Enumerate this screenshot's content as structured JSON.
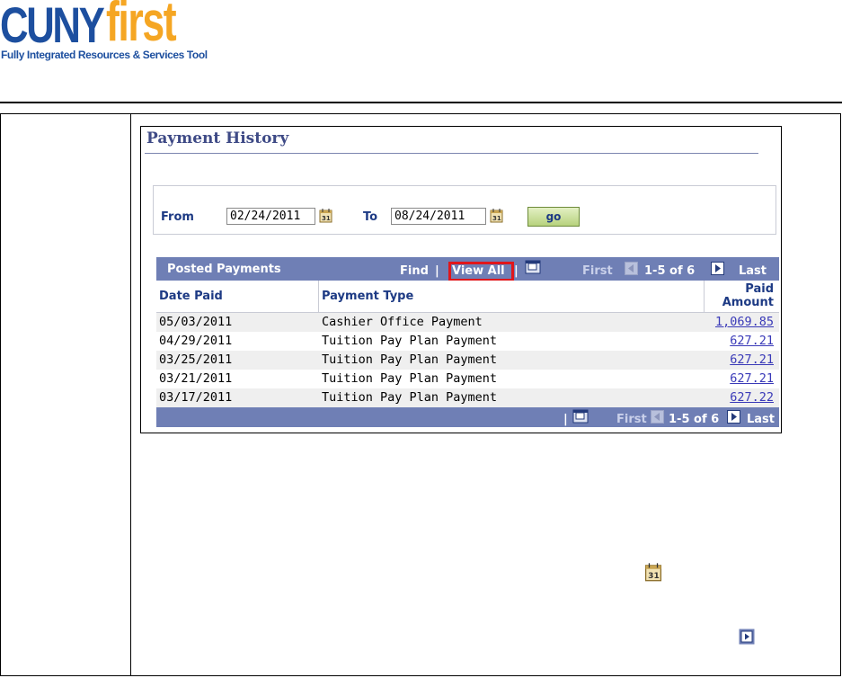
{
  "logo": {
    "brand_a": "CUNY",
    "brand_b": "first",
    "tagline": "Fully Integrated Resources & Services Tool"
  },
  "payment_history": {
    "title": "Payment History",
    "search": {
      "from_label": "From",
      "from_value": "02/24/2011",
      "to_label": "To",
      "to_value": "08/24/2011",
      "go_label": "go"
    },
    "grid": {
      "title": "Posted Payments",
      "find_label": "Find",
      "separator": "|",
      "view_all_label": "View All",
      "first_label": "First",
      "range_label": "1-5 of 6",
      "last_label": "Last",
      "columns": {
        "date_paid": "Date Paid",
        "payment_type": "Payment Type",
        "paid_amount_line1": "Paid",
        "paid_amount_line2": "Amount"
      },
      "rows": [
        {
          "date": "05/03/2011",
          "type": "Cashier Office Payment",
          "amount": "1,069.85"
        },
        {
          "date": "04/29/2011",
          "type": "Tuition Pay Plan Payment",
          "amount": "627.21"
        },
        {
          "date": "03/25/2011",
          "type": "Tuition Pay Plan Payment",
          "amount": "627.21"
        },
        {
          "date": "03/21/2011",
          "type": "Tuition Pay Plan Payment",
          "amount": "627.21"
        },
        {
          "date": "03/17/2011",
          "type": "Tuition Pay Plan Payment",
          "amount": "627.22"
        }
      ]
    }
  },
  "icons": {
    "calendar": "calendar-icon",
    "zoom": "zoom-window-icon",
    "prev": "arrow-left-icon",
    "next": "arrow-right-icon"
  },
  "colors": {
    "brand_blue": "#1d4f9f",
    "brand_orange": "#f5a623",
    "grid_header": "#6f7fb5",
    "highlight_red": "#e0161b",
    "link_blue": "#3a3ab8"
  }
}
